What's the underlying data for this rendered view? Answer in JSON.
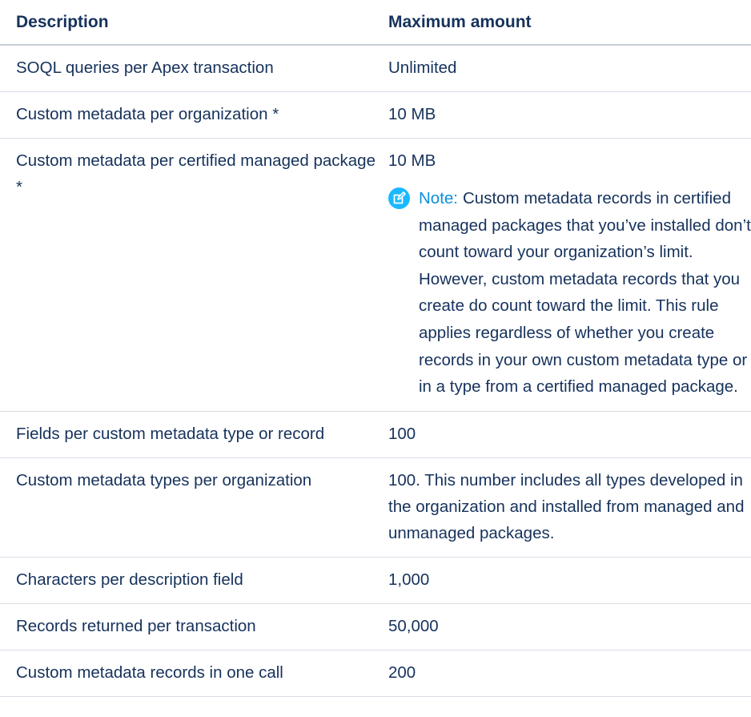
{
  "table": {
    "header": {
      "description": "Description",
      "maximum": "Maximum amount"
    },
    "rows": [
      {
        "description": "SOQL queries per Apex transaction",
        "maximum": "Unlimited"
      },
      {
        "description": "Custom metadata per organization *",
        "maximum": "10 MB"
      },
      {
        "description": "Custom metadata per certified managed package *",
        "maximum": "10 MB",
        "note": {
          "label": "Note:",
          "text": "Custom metadata records in certified managed packages that you’ve installed don’t count toward your organization’s limit. However, custom metadata records that you create do count toward the limit. This rule applies regardless of whether you create records in your own custom metadata type or in a type from a certified managed package."
        }
      },
      {
        "description": "Fields per custom metadata type or record",
        "maximum": "100"
      },
      {
        "description": "Custom metadata types per organization",
        "maximum": "100. This number includes all types developed in the organization and installed from managed and unmanaged packages."
      },
      {
        "description": "Characters per description field",
        "maximum": "1,000"
      },
      {
        "description": "Records returned per transaction",
        "maximum": "50,000"
      },
      {
        "description": "Custom metadata records in one call",
        "maximum": "200"
      }
    ]
  },
  "icons": {
    "note": "edit-note-icon"
  },
  "colors": {
    "text": "#16325c",
    "note_accent": "#1ab9ff",
    "note_label": "#0b8fe0",
    "divider": "#d8dde6"
  }
}
